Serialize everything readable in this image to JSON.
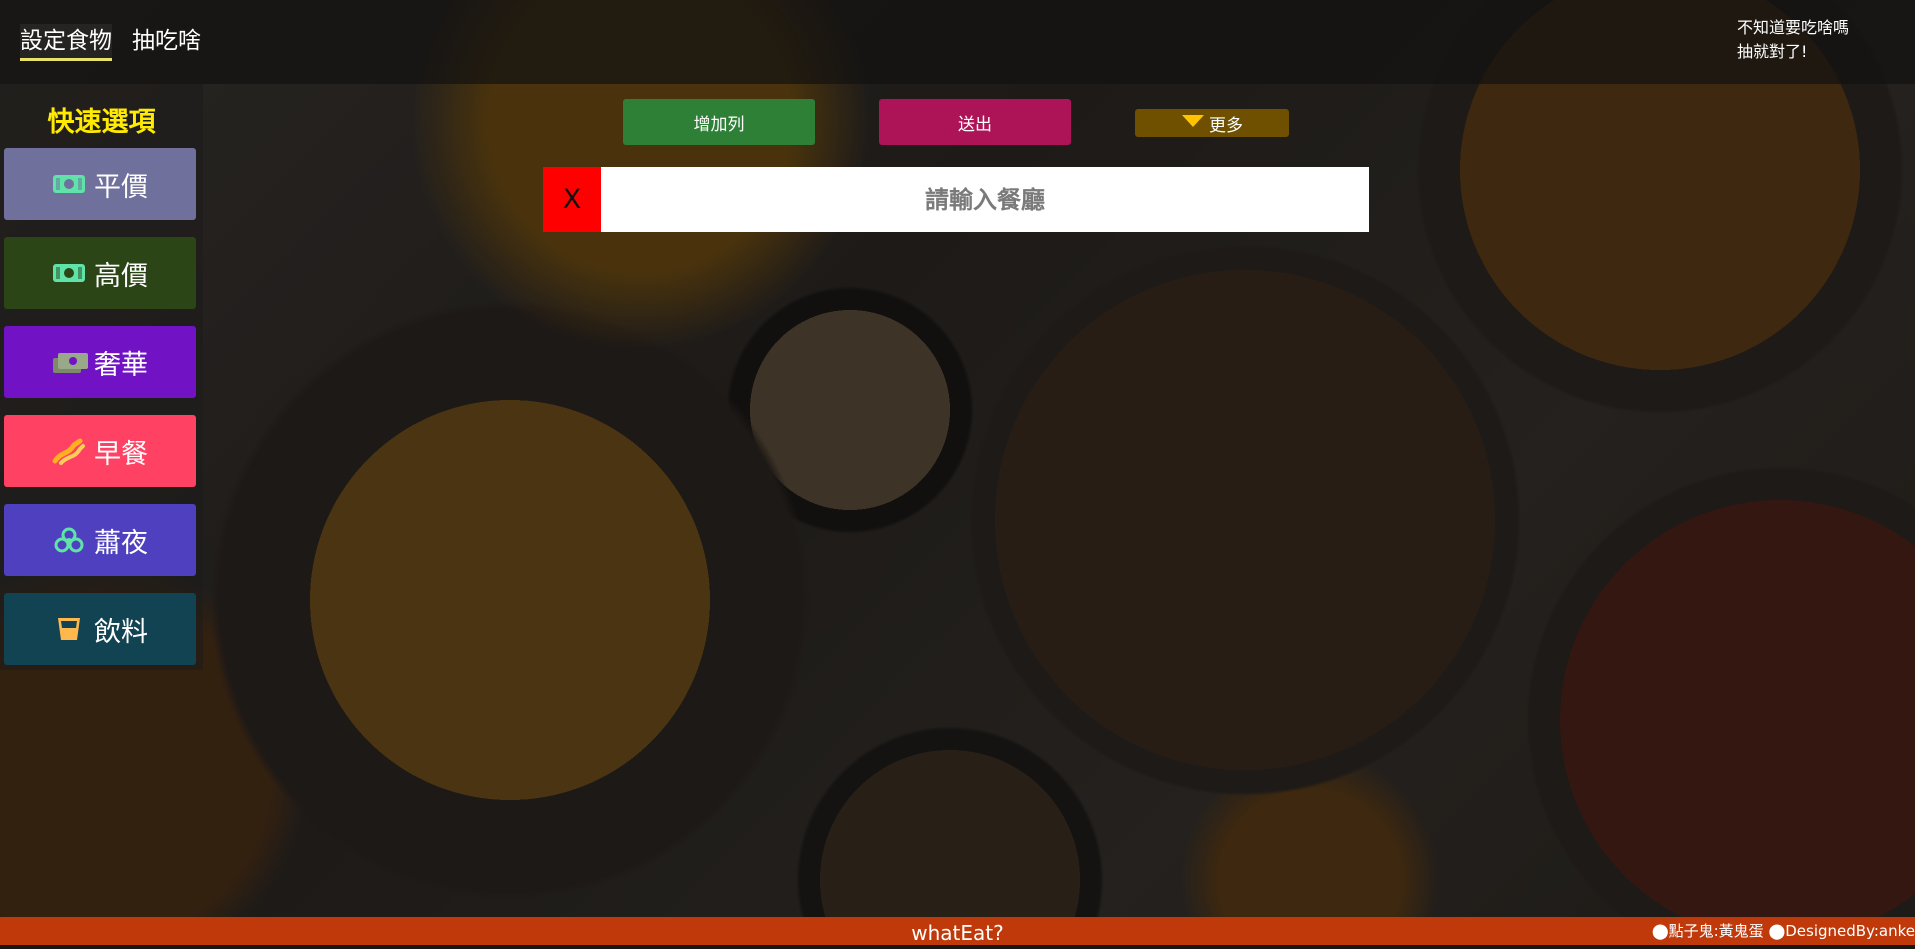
{
  "nav": {
    "tabs": [
      {
        "label": "設定食物"
      },
      {
        "label": "抽吃啥"
      }
    ],
    "slogan_line1": "不知道要吃啥嗎",
    "slogan_line2": "抽就對了!"
  },
  "sidebar": {
    "title": "快速選項",
    "items": [
      {
        "label": "平價",
        "icon": "money-bill-icon",
        "color": "#6f709c"
      },
      {
        "label": "高價",
        "icon": "money-bill-icon",
        "color": "#2b4517"
      },
      {
        "label": "奢華",
        "icon": "money-bills-icon",
        "color": "#7113c4"
      },
      {
        "label": "早餐",
        "icon": "bacon-icon",
        "color": "#ff4163"
      },
      {
        "label": "蕭夜",
        "icon": "biohazard-icon",
        "color": "#4f40bf"
      },
      {
        "label": "飲料",
        "icon": "cup-icon",
        "color": "#124352"
      }
    ]
  },
  "controls": {
    "add_row_label": "增加列",
    "submit_label": "送出",
    "more_label": "更多"
  },
  "restaurant_row": {
    "delete_label": "X",
    "placeholder": "請輸入餐廳"
  },
  "footer": {
    "title": "whatEat?",
    "credits": "⬤點子鬼:黃鬼蛋 ⬤DesignedBy:anke"
  },
  "colors": {
    "add_row": "#2f8037",
    "submit": "#ad1457",
    "more": "#6e5000",
    "footer": "#c0390a",
    "delete": "#ff0000",
    "title_yellow": "#ffea00"
  }
}
